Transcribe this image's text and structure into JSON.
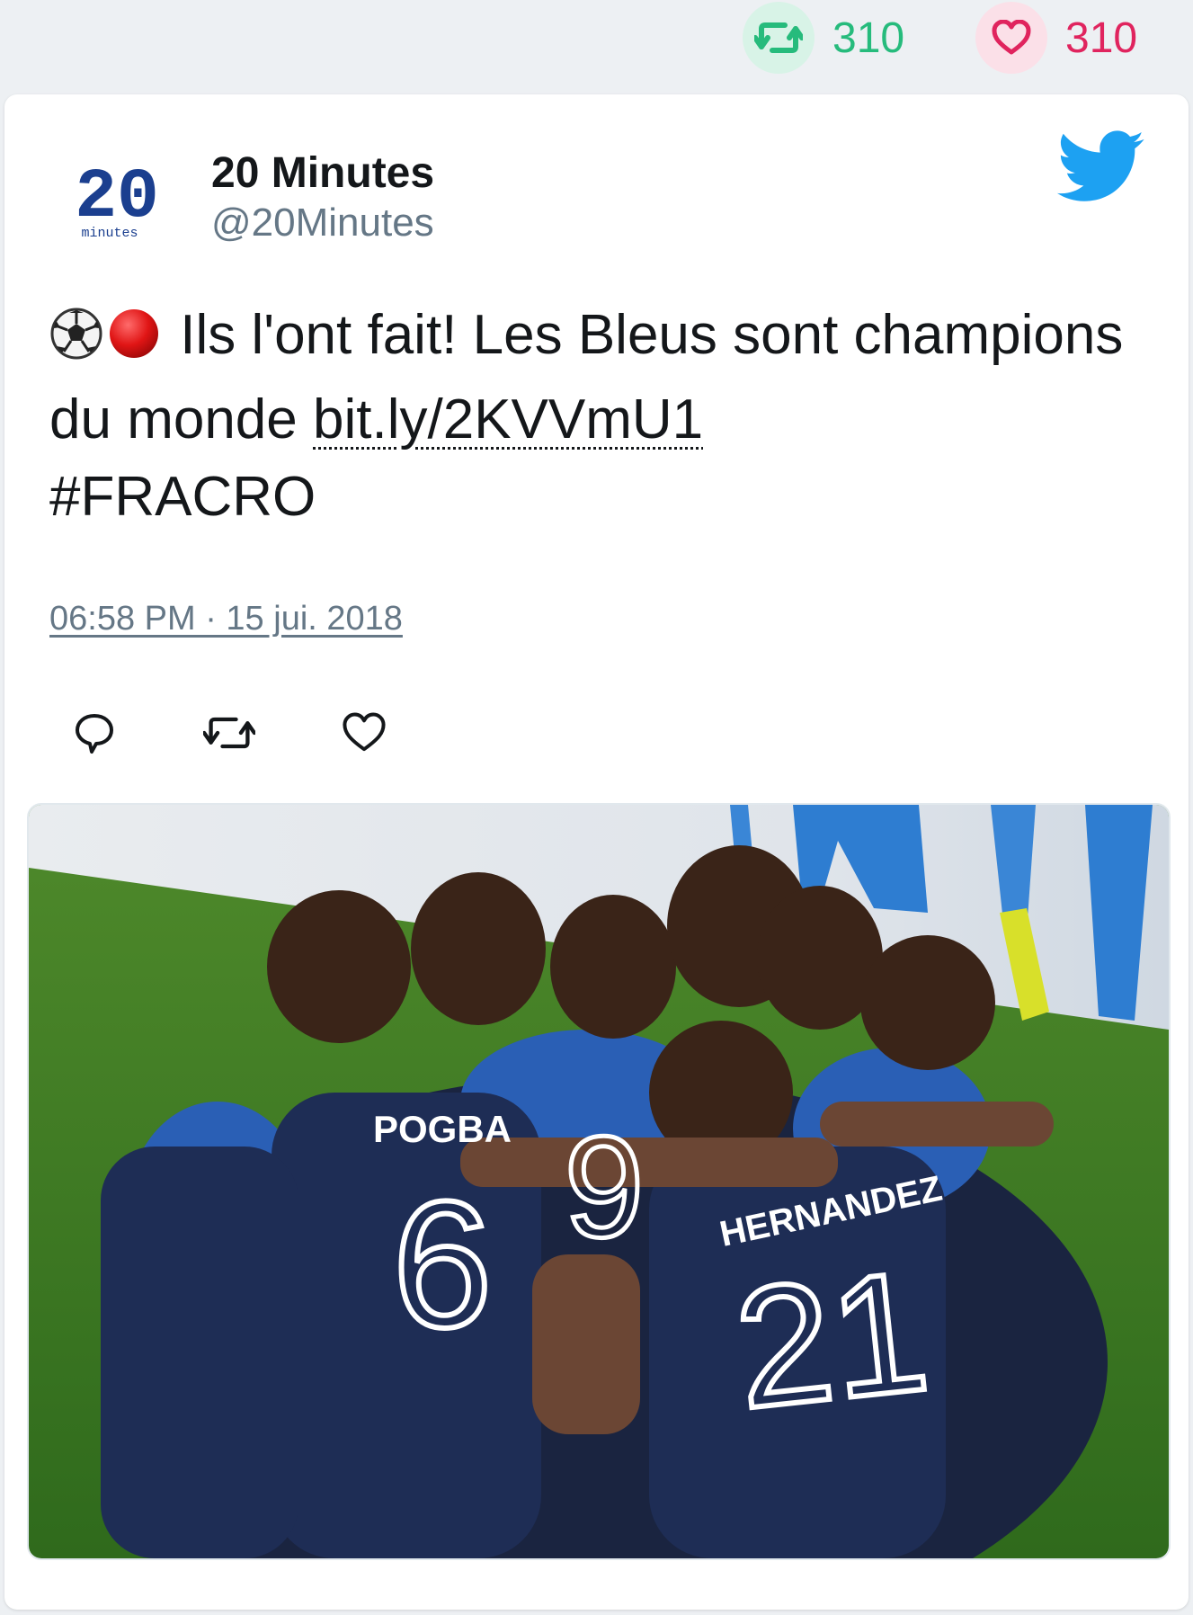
{
  "stats": {
    "retweet_count": "310",
    "like_count": "310"
  },
  "tweet": {
    "author_name": "20 Minutes",
    "author_handle": "@20Minutes",
    "avatar_text": "20",
    "avatar_subtext": "minutes",
    "text_part1": " Ils l'ont fait! Les Bleus sont champions du monde ",
    "link": "bit.ly/2KVVmU1",
    "hashtag": "#FRACRO",
    "timestamp": "06:58 PM · 15 jui. 2018",
    "media_jersey_1": "POGBA",
    "media_number_1": "6",
    "media_jersey_2": "HERNANDEZ",
    "media_number_2": "21",
    "media_number_3": "9"
  },
  "icons": {
    "retweet": "retweet-icon",
    "like": "heart-icon",
    "reply": "reply-icon",
    "brand": "twitter-bird-icon",
    "emoji_1": "soccer-ball-icon",
    "emoji_2": "red-circle-icon"
  },
  "colors": {
    "retweet": "#26bb7c",
    "like": "#e0245e",
    "twitter_blue": "#1da1f2",
    "text": "#14171a",
    "muted": "#657786",
    "avatar_blue": "#1b3f8f"
  }
}
